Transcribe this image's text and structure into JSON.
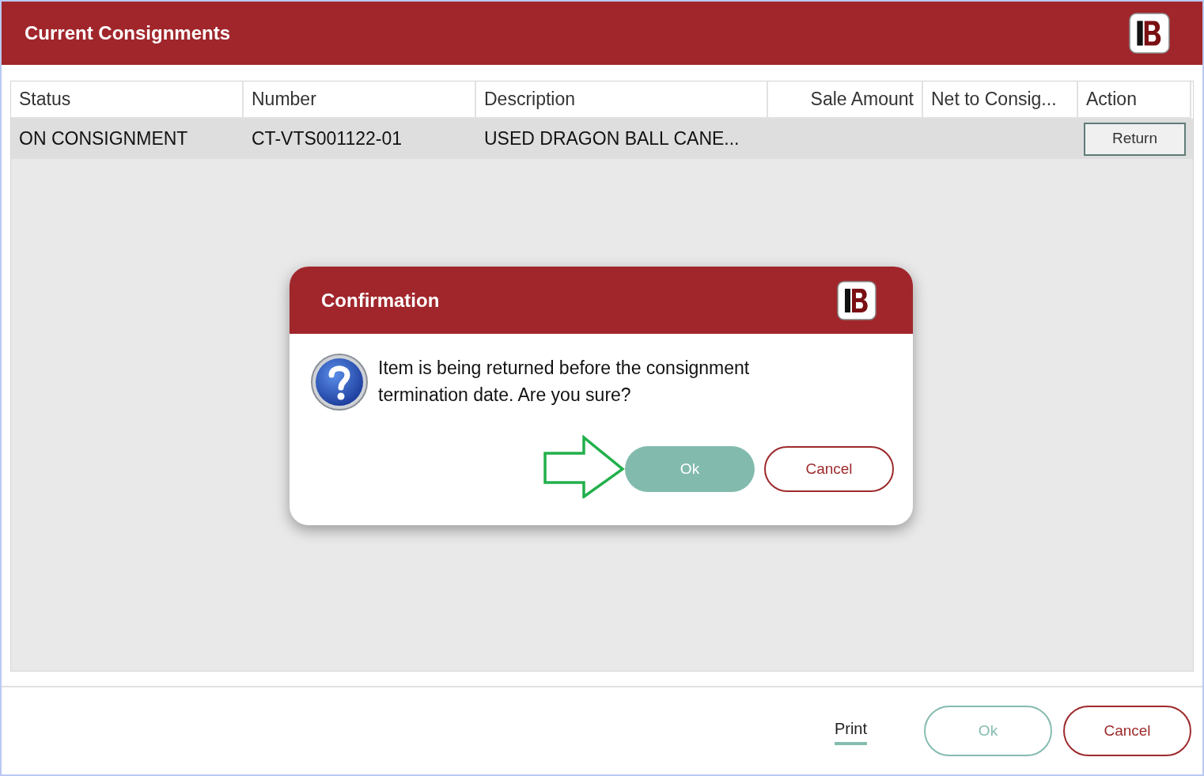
{
  "window": {
    "title": "Current Consignments"
  },
  "table": {
    "columns": [
      {
        "label": "Status"
      },
      {
        "label": "Number"
      },
      {
        "label": "Description"
      },
      {
        "label": "Sale Amount"
      },
      {
        "label": "Net to Consig..."
      },
      {
        "label": "Action"
      }
    ],
    "rows": [
      {
        "status": "ON CONSIGNMENT",
        "number": "CT-VTS001122-01",
        "description": "USED DRAGON BALL CANE...",
        "action": "Return"
      }
    ]
  },
  "dialog": {
    "title": "Confirmation",
    "message": "Item is being returned before the consignment termination date. Are you sure?",
    "buttons": [
      {
        "label": "Ok",
        "kind": "primary"
      },
      {
        "label": "Cancel",
        "kind": "secondary"
      }
    ]
  },
  "footer": {
    "link": "Print",
    "buttons": [
      {
        "label": "Ok",
        "kind": "primary",
        "disabled": true
      },
      {
        "label": "Cancel",
        "kind": "secondary",
        "disabled": false
      }
    ]
  }
}
